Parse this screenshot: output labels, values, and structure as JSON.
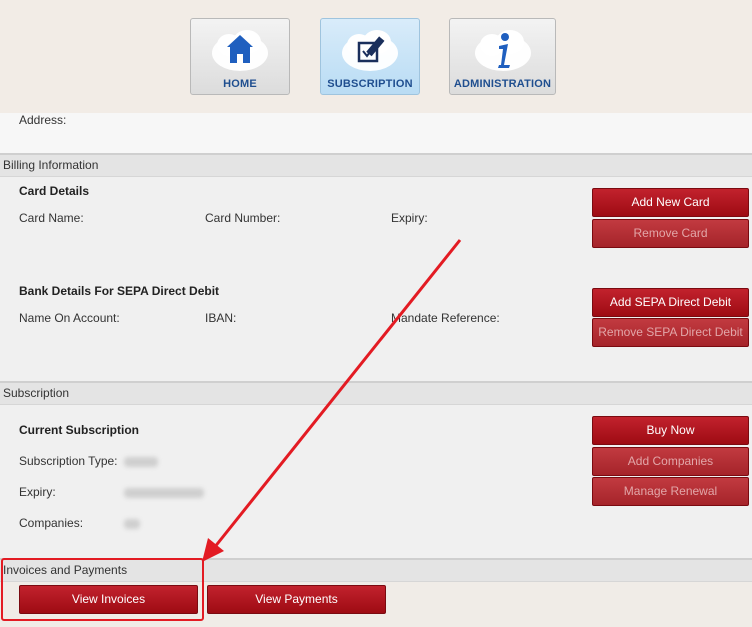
{
  "nav": {
    "items": [
      {
        "label": "HOME",
        "icon": "home-icon"
      },
      {
        "label": "SUBSCRIPTION",
        "icon": "edit-icon",
        "active": true
      },
      {
        "label": "ADMINISTRATION",
        "icon": "info-icon"
      }
    ]
  },
  "account": {
    "address_label": "Address:"
  },
  "billing": {
    "title": "Billing Information",
    "card": {
      "heading": "Card Details",
      "name_label": "Card Name:",
      "number_label": "Card Number:",
      "expiry_label": "Expiry:",
      "add_button": "Add New Card",
      "remove_button": "Remove Card"
    },
    "bank": {
      "heading": "Bank Details For SEPA Direct Debit",
      "name_label": "Name On Account:",
      "iban_label": "IBAN:",
      "mandate_label": "Mandate Reference:",
      "add_button": "Add SEPA Direct Debit",
      "remove_button": "Remove SEPA Direct Debit"
    }
  },
  "subscription": {
    "title": "Subscription",
    "heading": "Current Subscription",
    "type_label": "Subscription Type:",
    "expiry_label": "Expiry:",
    "companies_label": "Companies:",
    "buy_button": "Buy Now",
    "add_companies_button": "Add Companies",
    "manage_renewal_button": "Manage Renewal"
  },
  "invoices": {
    "title": "Invoices and Payments",
    "view_invoices_button": "View Invoices",
    "view_payments_button": "View Payments"
  },
  "colors": {
    "primary_button": "#a8101a",
    "nav_active": "#c4e2f7",
    "annotation": "#e31b23"
  }
}
